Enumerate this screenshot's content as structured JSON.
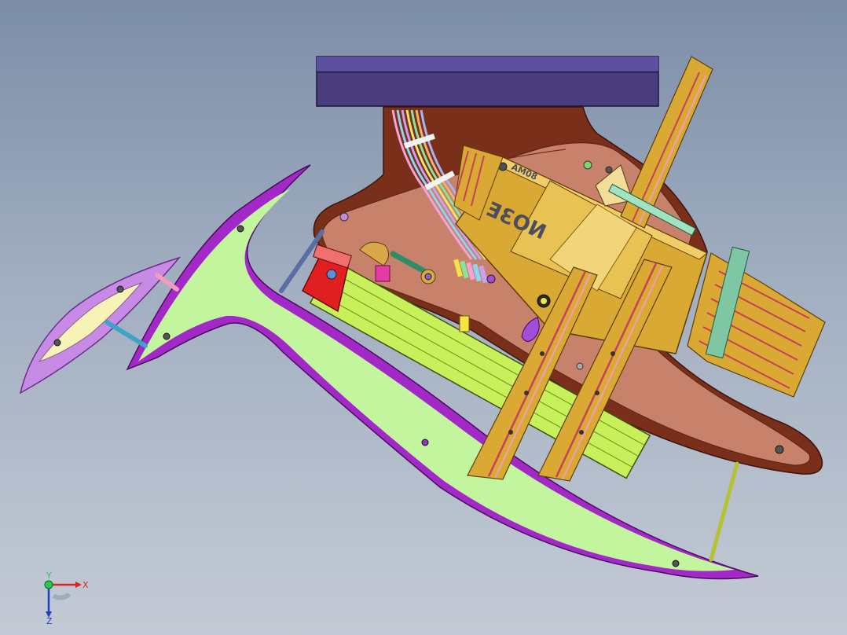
{
  "model": {
    "housing_brand_text": "NO3E",
    "tag_label_text": "AM08"
  },
  "triad": {
    "x_label": "X",
    "y_label": "Y",
    "z_label": "Z"
  },
  "colors": {
    "background_top": "#7c8da7",
    "background_bottom": "#c3cad5",
    "top_bar": "#4a3d7d",
    "frame_brown": "#7a2f1a",
    "frame_fill": "#c8826b",
    "green_plate": "#c2f59d",
    "purple_outline": "#a328c8",
    "housing_gold": "#d9a933",
    "extrusion_green": "#c7f05a",
    "motor_red": "#e02020"
  },
  "icons": {
    "axis_triad": "axis-triad-icon"
  }
}
